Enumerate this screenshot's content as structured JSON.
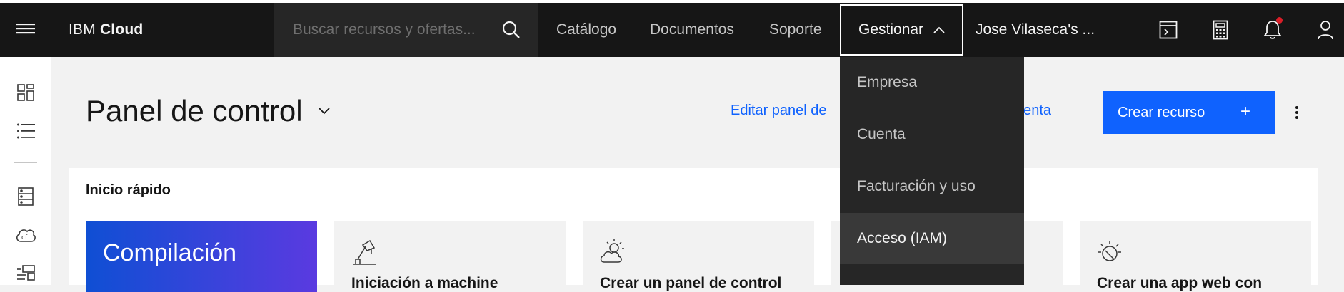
{
  "header": {
    "brand_prefix": "IBM",
    "brand_name": "Cloud",
    "search_placeholder": "Buscar recursos y ofertas...",
    "nav": {
      "catalog": "Catálogo",
      "docs": "Documentos",
      "support": "Soporte",
      "manage": "Gestionar",
      "account": "Jose Vilaseca's ..."
    },
    "icons": [
      "menu-icon",
      "search-icon",
      "terminal-icon",
      "calculator-icon",
      "notification-icon",
      "user-icon"
    ]
  },
  "manage_menu": {
    "items": [
      {
        "label": "Empresa"
      },
      {
        "label": "Cuenta"
      },
      {
        "label": "Facturación y uso"
      },
      {
        "label": "Acceso (IAM)",
        "highlighted": true
      }
    ]
  },
  "dashboard": {
    "title": "Panel de control",
    "edit_link": "Editar panel de",
    "account_link_fragment": "cuenta",
    "create_button": "Crear recurso",
    "create_button_icon": "+"
  },
  "quick_start": {
    "title": "Inicio rápido",
    "tiles": [
      {
        "title": "Compilación"
      },
      {
        "title": "Iniciación a machine"
      },
      {
        "title": "Crear un panel de control"
      },
      {
        "title": ""
      },
      {
        "title": "Crear una app web con"
      }
    ]
  },
  "colors": {
    "header_bg": "#161616",
    "primary": "#0f62fe",
    "dropdown_bg": "#262626",
    "dropdown_active": "#393939",
    "notification": "#da1e28"
  }
}
